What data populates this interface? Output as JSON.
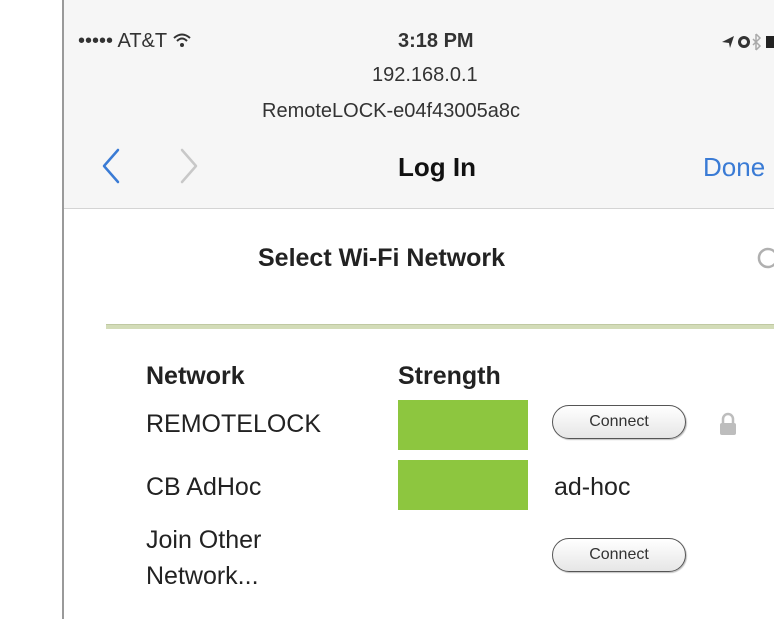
{
  "status_bar": {
    "carrier": "••••• AT&T",
    "time": "3:18 PM"
  },
  "address": {
    "host": "192.168.0.1",
    "device": "RemoteLOCK-e04f43005a8c"
  },
  "nav": {
    "title": "Log In",
    "done_label": "Done"
  },
  "page": {
    "heading": "Select Wi-Fi Network",
    "columns": [
      "Network",
      "Strength"
    ],
    "networks": [
      {
        "name": "REMOTELOCK",
        "strength_fraction": 1.0,
        "action": "Connect",
        "secured": true
      },
      {
        "name": "CB AdHoc",
        "strength_fraction": 1.0,
        "type": "ad-hoc"
      }
    ],
    "join_other": {
      "line1": "Join Other",
      "line2": "Network...",
      "action": "Connect"
    }
  },
  "colors": {
    "strength_bar": "#8dc63f",
    "link": "#3a7bd5"
  },
  "icons": [
    "wifi-icon",
    "location-icon",
    "alarm-icon",
    "bluetooth-icon",
    "battery-icon",
    "back-chevron-icon",
    "forward-chevron-icon",
    "refresh-icon",
    "lock-icon"
  ]
}
